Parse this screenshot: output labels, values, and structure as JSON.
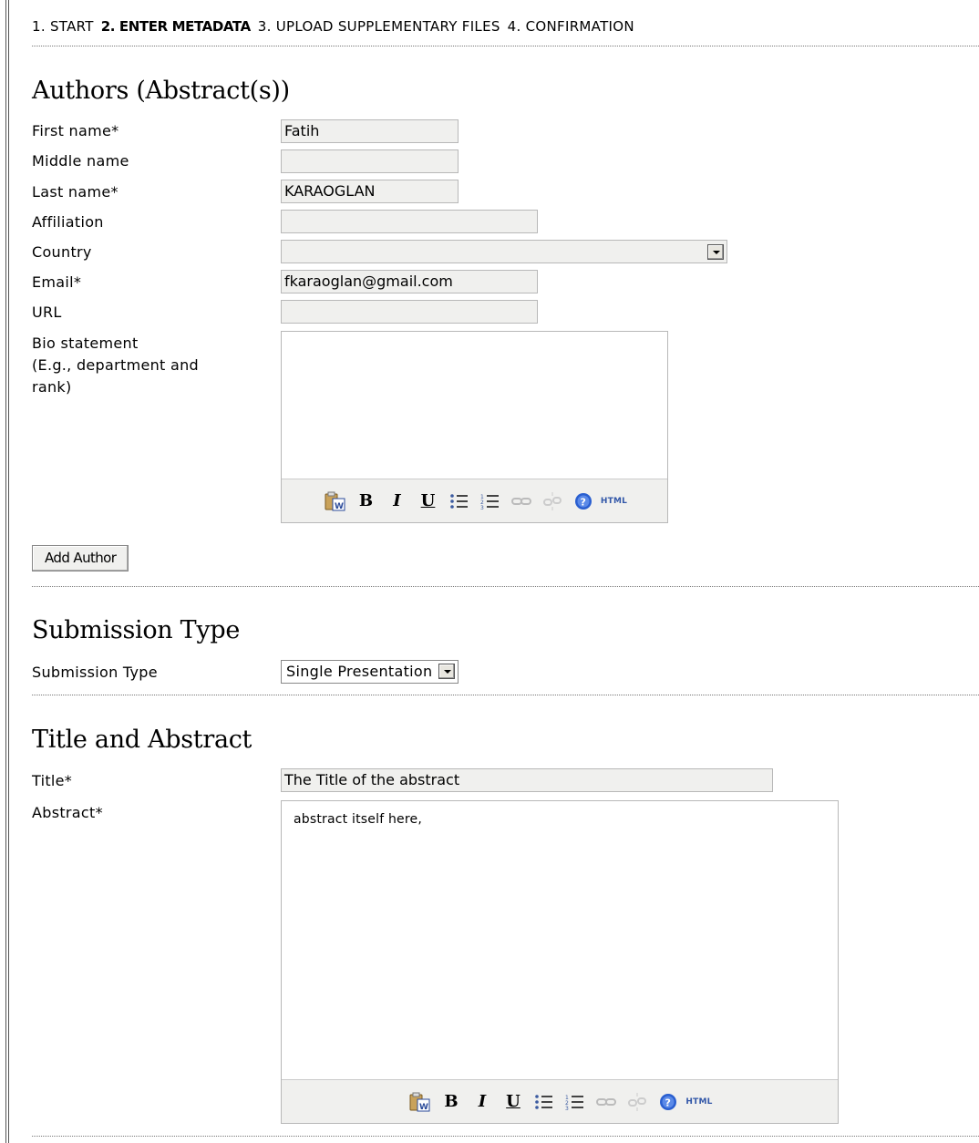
{
  "steps": {
    "step1": "1. START",
    "step2": "2. ENTER METADATA",
    "step3": "3. UPLOAD SUPPLEMENTARY FILES",
    "step4": "4. CONFIRMATION",
    "current": "2. ENTER METADATA"
  },
  "authors": {
    "heading": "Authors (Abstract(s))",
    "first_name_label": "First name*",
    "first_name_value": "Fatih",
    "middle_name_label": "Middle name",
    "middle_name_value": "",
    "last_name_label": "Last name*",
    "last_name_value": "KARAOGLAN",
    "affiliation_label": "Affiliation",
    "affiliation_value": "",
    "country_label": "Country",
    "country_value": "",
    "email_label": "Email*",
    "email_value": "fkaraoglan@gmail.com",
    "url_label": "URL",
    "url_value": "",
    "bio_label_line1": "Bio statement",
    "bio_label_line2": "(E.g., department and",
    "bio_label_line3": "rank)",
    "bio_value": "",
    "add_author_label": "Add Author"
  },
  "submission_type": {
    "heading": "Submission Type",
    "label": "Submission Type",
    "value": "Single Presentation"
  },
  "title_abstract": {
    "heading": "Title and Abstract",
    "title_label": "Title*",
    "title_value": "The Title of the abstract",
    "abstract_label": "Abstract*",
    "abstract_value": "abstract itself here,"
  },
  "toolbar": {
    "bold": "B",
    "italic": "I",
    "underline": "U",
    "html": "HTML"
  },
  "colors": {
    "input_bg": "#f0f0ee",
    "help_icon": "#2a5fd0"
  }
}
